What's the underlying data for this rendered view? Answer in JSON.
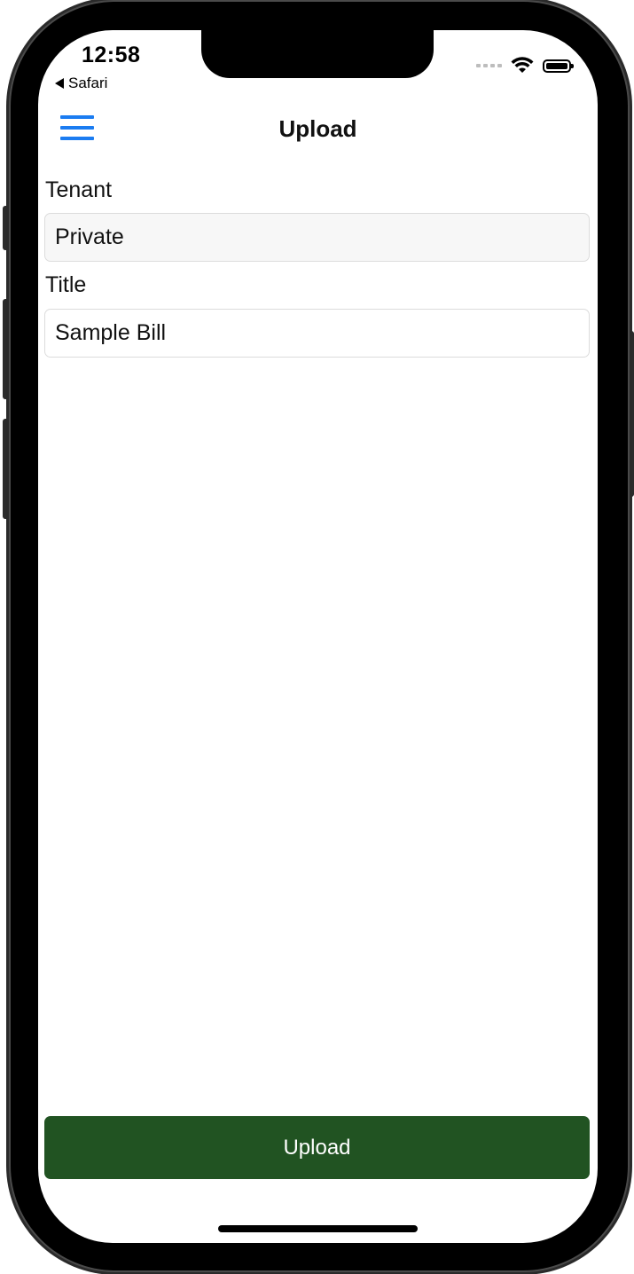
{
  "status_bar": {
    "time": "12:58",
    "back_app": "Safari",
    "wifi_icon": "wifi-icon",
    "battery_icon": "battery-icon"
  },
  "header": {
    "title": "Upload",
    "menu_icon": "hamburger-menu-icon"
  },
  "form": {
    "tenant": {
      "label": "Tenant",
      "value": "Private"
    },
    "title": {
      "label": "Title",
      "value": "Sample Bill"
    }
  },
  "actions": {
    "upload_label": "Upload"
  },
  "colors": {
    "accent": "#1b7cf1",
    "button": "#215322"
  }
}
